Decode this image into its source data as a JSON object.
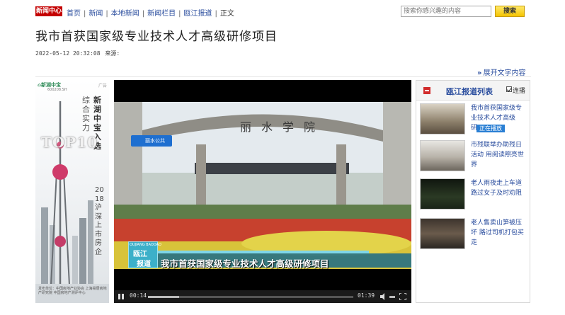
{
  "nav": {
    "logo": "新闻中心",
    "breadcrumbs": [
      "首页",
      "新闻",
      "本地新闻",
      "新闻栏目",
      "瓯江报道"
    ],
    "separator": "|",
    "current": "正文",
    "search_placeholder": "搜索你感兴趣的内容",
    "search_button": "搜索"
  },
  "article": {
    "title": "我市首获国家级专业技术人才高级研修项目",
    "datetime": "2022-05-12 20:32:08",
    "source_label": "来源:",
    "expand_link": "展开文字内容"
  },
  "ad": {
    "brand": "新湖中宝",
    "code": "600208.SH",
    "tag": "广告",
    "line1": "新湖中宝入选",
    "line2": "综合实力",
    "badge": "TOP10",
    "line3": "2018沪深上市房企",
    "footer": "发布单位：中国房地产业协会 上海易居房地产研究院 中国房地产测评中心"
  },
  "video": {
    "station": "丽水公共",
    "gate_text": "丽水学院",
    "lower_third_pinyin": "OUJIANG BAODAO",
    "lower_third_logo_1": "瓯江",
    "lower_third_logo_2": "报道",
    "lower_third_title": "我市首获国家级专业技术人才高级研修项目",
    "time_current": "00:14",
    "time_total": "01:39",
    "progress": 0.15
  },
  "playlist": {
    "title": "瓯江报道列表",
    "autoplay_label": "连播",
    "autoplay_checked": true,
    "now_playing_badge": "正在播放",
    "items": [
      {
        "title": "我市首获国家级专业技术人才高级研…"
      },
      {
        "title": "市残联举办助残日活动 用阅读照亮世界"
      },
      {
        "title": "老人雨夜走上车道 路过女子及时劝阻"
      },
      {
        "title": "老人售卖山笋被压坏 路过司机打包买走"
      }
    ]
  }
}
